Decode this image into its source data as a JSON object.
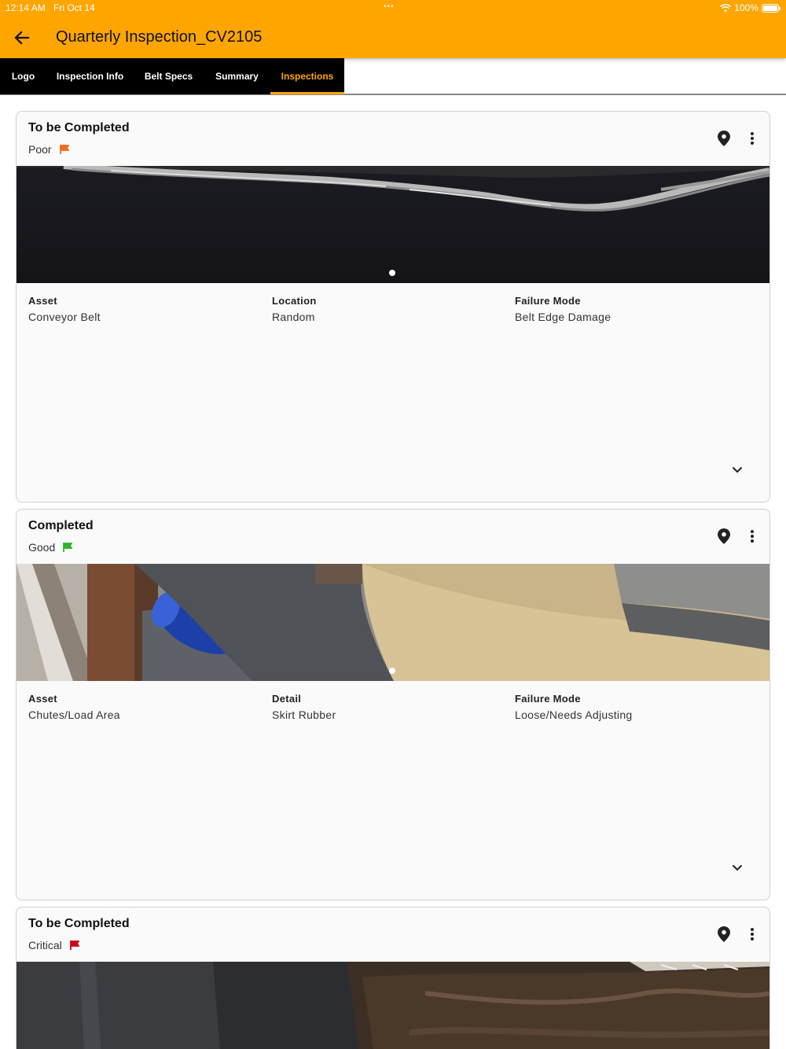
{
  "status_bar": {
    "time": "12:14 AM",
    "date": "Fri Oct 14",
    "battery": "100%",
    "battery_level": 1.0
  },
  "header": {
    "title": "Quarterly Inspection_CV2105",
    "back_icon": "arrow-left-icon",
    "background": "#FFA500"
  },
  "tabs": [
    {
      "label": "Logo",
      "active": false
    },
    {
      "label": "Inspection Info",
      "active": false
    },
    {
      "label": "Belt Specs",
      "active": false
    },
    {
      "label": "Summary",
      "active": false
    },
    {
      "label": "Inspections",
      "active": true
    }
  ],
  "colors": {
    "accent": "#FFA500",
    "flag_poor": "#F26B1D",
    "flag_good": "#2DB32D",
    "flag_critical": "#D0021B"
  },
  "inspections": [
    {
      "status": "To be Completed",
      "condition": "Poor",
      "flag_color": "#F26B1D",
      "fields": [
        {
          "label": "Asset",
          "value": "Conveyor Belt"
        },
        {
          "label": "Location",
          "value": "Random"
        },
        {
          "label": "Failure Mode",
          "value": "Belt Edge Damage"
        }
      ]
    },
    {
      "status": "Completed",
      "condition": "Good",
      "flag_color": "#2DB32D",
      "fields": [
        {
          "label": "Asset",
          "value": "Chutes/Load Area"
        },
        {
          "label": "Detail",
          "value": "Skirt Rubber"
        },
        {
          "label": "Failure Mode",
          "value": "Loose/Needs Adjusting"
        }
      ]
    },
    {
      "status": "To be Completed",
      "condition": "Critical",
      "flag_color": "#D0021B",
      "fields": []
    }
  ]
}
